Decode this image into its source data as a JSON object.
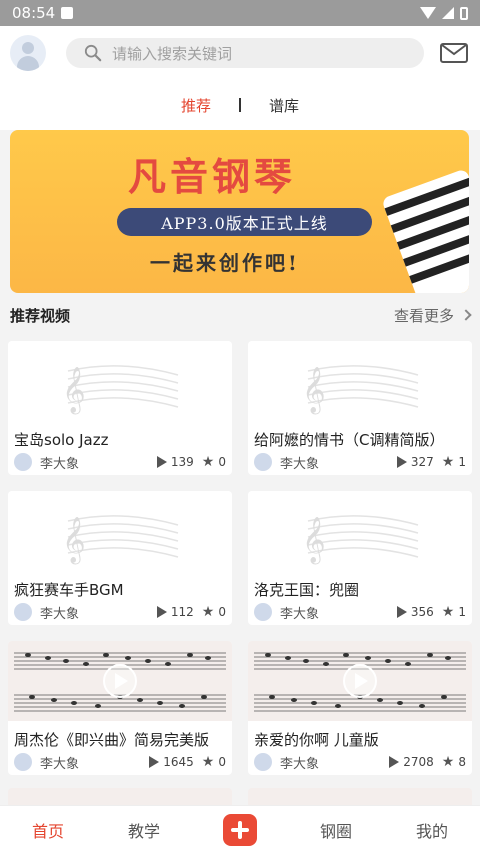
{
  "status_bar": {
    "time": "08:54"
  },
  "header": {
    "search_placeholder": "请输入搜索关键词"
  },
  "tabs": [
    {
      "label": "推荐",
      "active": true
    },
    {
      "label": "谱库",
      "active": false
    }
  ],
  "banner": {
    "title_part1": "凡音",
    "title_part2": "钢琴",
    "pill": "APP3.0版本正式上线",
    "subtitle": "一起来创作吧!"
  },
  "section": {
    "title": "推荐视频",
    "more": "查看更多"
  },
  "cards": [
    {
      "title": "宝岛solo Jazz",
      "user": "李大象",
      "plays": "139",
      "stars": "0",
      "thumb": "blank"
    },
    {
      "title": "给阿嬷的情书（C调精简版）",
      "user": "李大象",
      "plays": "327",
      "stars": "1",
      "thumb": "blank"
    },
    {
      "title": "疯狂赛车手BGM",
      "user": "李大象",
      "plays": "112",
      "stars": "0",
      "thumb": "blank"
    },
    {
      "title": "洛克王国：兜圈",
      "user": "李大象",
      "plays": "356",
      "stars": "1",
      "thumb": "blank"
    },
    {
      "title": "周杰伦《即兴曲》简易完美版",
      "user": "李大象",
      "plays": "1645",
      "stars": "0",
      "thumb": "sheet"
    },
    {
      "title": "亲爱的你啊 儿童版",
      "user": "李大象",
      "plays": "2708",
      "stars": "8",
      "thumb": "sheet"
    }
  ],
  "tabbar": [
    {
      "label": "首页",
      "active": true
    },
    {
      "label": "教学",
      "active": false
    },
    {
      "label": "钢圈",
      "active": false
    },
    {
      "label": "我的",
      "active": false
    }
  ],
  "colors": {
    "accent": "#e4452f",
    "banner": "#fcb746"
  }
}
